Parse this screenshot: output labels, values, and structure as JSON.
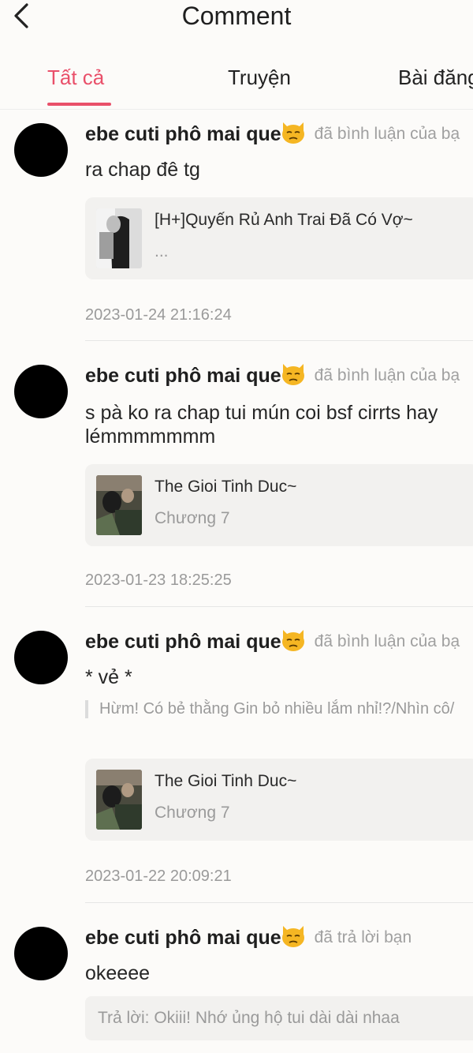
{
  "header": {
    "title": "Comment",
    "back_icon": "chevron-left-icon"
  },
  "tabs": [
    {
      "label": "Tất cả",
      "active": true
    },
    {
      "label": "Truyện",
      "active": false
    },
    {
      "label": "Bài đăng",
      "active": false
    }
  ],
  "colors": {
    "accent": "#e9506a",
    "background": "#fcfbf9",
    "card": "#f2f1ef"
  },
  "items": [
    {
      "username": "ebe cuti phô mai que",
      "action": "đã bình luận của bạ",
      "comment": "ra chap đê tg",
      "card": {
        "title": "[H+]Quyến Rủ Anh Trai Đã Có Vợ~",
        "subtitle": "..."
      },
      "date": "2023-01-24 21:16:24"
    },
    {
      "username": "ebe cuti phô mai que",
      "action": "đã bình luận của bạ",
      "comment": "s pà ko ra chap tui mún coi bsf cirrts hay lémmmmmmm",
      "card": {
        "title": "The Gioi Tinh Duc~",
        "subtitle": "Chương 7"
      },
      "date": "2023-01-23 18:25:25"
    },
    {
      "username": "ebe cuti phô mai que",
      "action": "đã bình luận của bạ",
      "comment": "* vẻ *",
      "quote": "Hừm! Có bẻ thằng Gin bỏ nhiều lắm nhỉ!?/Nhìn cô/",
      "card": {
        "title": "The Gioi Tinh Duc~",
        "subtitle": "Chương 7"
      },
      "date": "2023-01-22 20:09:21"
    },
    {
      "username": "ebe cuti phô mai que",
      "action": "đã trả lời bạn",
      "comment": "okeeee",
      "reply": "Trả lời: Okiii! Nhớ ủng hộ tui dài dài nhaa"
    }
  ]
}
